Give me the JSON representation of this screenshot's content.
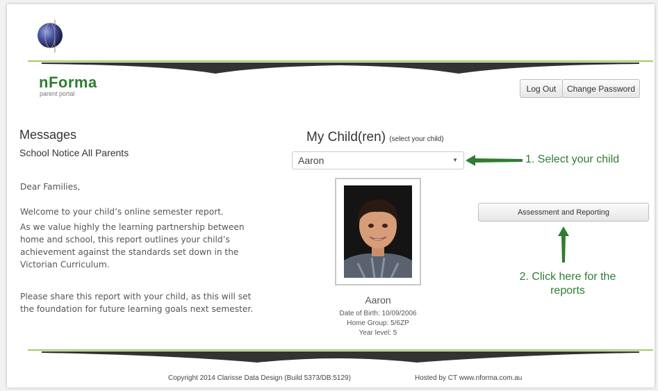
{
  "header": {
    "brand_name": "nForma",
    "brand_sub": "parent portal",
    "logout_label": "Log Out",
    "change_password_label": "Change Password"
  },
  "messages": {
    "title": "Messages",
    "subject": "School Notice All Parents",
    "paragraphs": [
      "Dear Families,",
      "Welcome to your child’s online semester report.",
      "As we value highly the learning partnership between home and school, this report outlines your child’s achievement against the standards set down in the Victorian Curriculum.",
      "Please share this report with your child, as this will set the foundation for future learning goals next semester."
    ]
  },
  "children": {
    "title": "My Child(ren)",
    "hint": "(select your child)",
    "selected": "Aaron",
    "child": {
      "name": "Aaron",
      "dob": "Date of Birth: 10/09/2006",
      "home_group": "Home Group: 5/6ZP",
      "year_level": "Year level: 5"
    },
    "assessment_button": "Assessment and Reporting"
  },
  "annotations": {
    "step1": "1. Select your child",
    "step2": "2. Click here for the reports"
  },
  "footer": {
    "copyright": "Copyright 2014 Clarisse Data Design (Build 5373/DB:5129)",
    "hosted": "Hosted by CT www.nforma.com.au"
  },
  "colors": {
    "brand_green": "#2e7d32",
    "annotation_green": "#2e7d32"
  },
  "icons": [
    "globe-logo-icon",
    "chevron-down-icon",
    "arrow-left-icon",
    "arrow-up-icon"
  ]
}
